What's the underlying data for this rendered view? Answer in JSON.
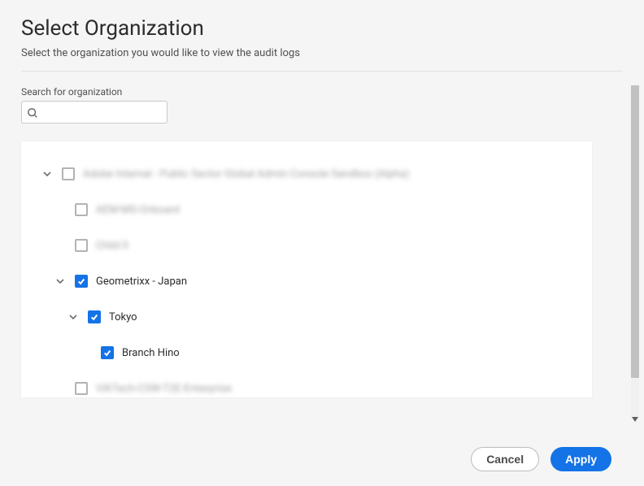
{
  "dialog": {
    "title": "Select Organization",
    "subtitle": "Select the organization you would like to view the audit logs"
  },
  "search": {
    "label": "Search for organization",
    "placeholder": ""
  },
  "tree": {
    "items": [
      {
        "level": 0,
        "chevron": true,
        "checked": false,
        "label": "Adobe Internal - Public Sector Global Admin Console Sandbox (Alpha)",
        "blurred": true
      },
      {
        "level": 1,
        "chevron": false,
        "checked": false,
        "label": "AEM-MS-Onboard",
        "blurred": true
      },
      {
        "level": 1,
        "chevron": false,
        "checked": false,
        "label": "Child 0",
        "blurred": true
      },
      {
        "level": 1,
        "chevron": true,
        "checked": true,
        "label": "Geometrixx - Japan",
        "blurred": false
      },
      {
        "level": 2,
        "chevron": true,
        "checked": true,
        "label": "Tokyo",
        "blurred": false
      },
      {
        "level": 3,
        "chevron": false,
        "checked": true,
        "label": "Branch Hino",
        "blurred": false
      },
      {
        "level": 1,
        "chevron": false,
        "checked": false,
        "label": "ViKTech-CSW-T2E-Enterprise",
        "blurred": true
      }
    ]
  },
  "buttons": {
    "cancel": "Cancel",
    "apply": "Apply"
  }
}
